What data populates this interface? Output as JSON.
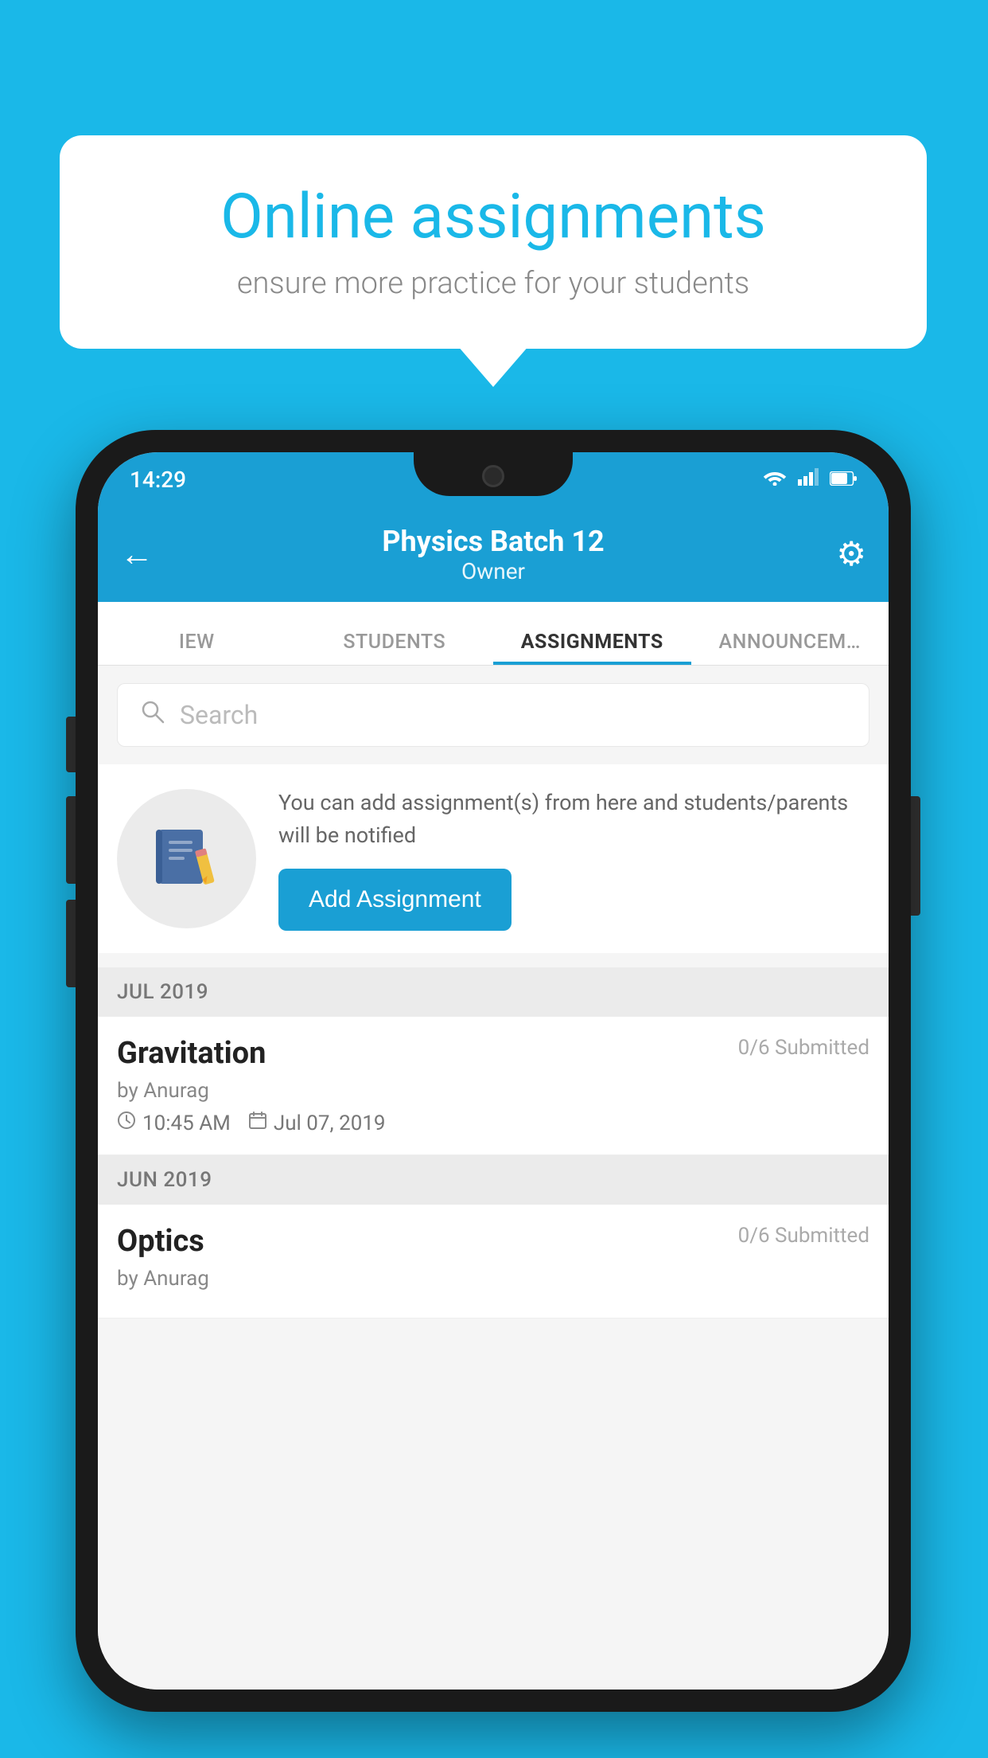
{
  "background_color": "#1ab8e8",
  "speech_bubble": {
    "title": "Online assignments",
    "subtitle": "ensure more practice for your students"
  },
  "status_bar": {
    "time": "14:29",
    "wifi_icon": "wifi",
    "signal_icon": "signal",
    "battery_icon": "battery"
  },
  "header": {
    "title": "Physics Batch 12",
    "subtitle": "Owner",
    "back_label": "←",
    "gear_label": "⚙"
  },
  "tabs": [
    {
      "label": "IEW",
      "active": false
    },
    {
      "label": "STUDENTS",
      "active": false
    },
    {
      "label": "ASSIGNMENTS",
      "active": true
    },
    {
      "label": "ANNOUNCEM…",
      "active": false
    }
  ],
  "search": {
    "placeholder": "Search"
  },
  "add_assignment": {
    "info_text": "You can add assignment(s) from here and students/parents will be notified",
    "button_label": "Add Assignment"
  },
  "sections": [
    {
      "month_label": "JUL 2019",
      "assignments": [
        {
          "name": "Gravitation",
          "submitted": "0/6 Submitted",
          "by": "by Anurag",
          "time": "10:45 AM",
          "date": "Jul 07, 2019"
        }
      ]
    },
    {
      "month_label": "JUN 2019",
      "assignments": [
        {
          "name": "Optics",
          "submitted": "0/6 Submitted",
          "by": "by Anurag",
          "time": "",
          "date": ""
        }
      ]
    }
  ]
}
